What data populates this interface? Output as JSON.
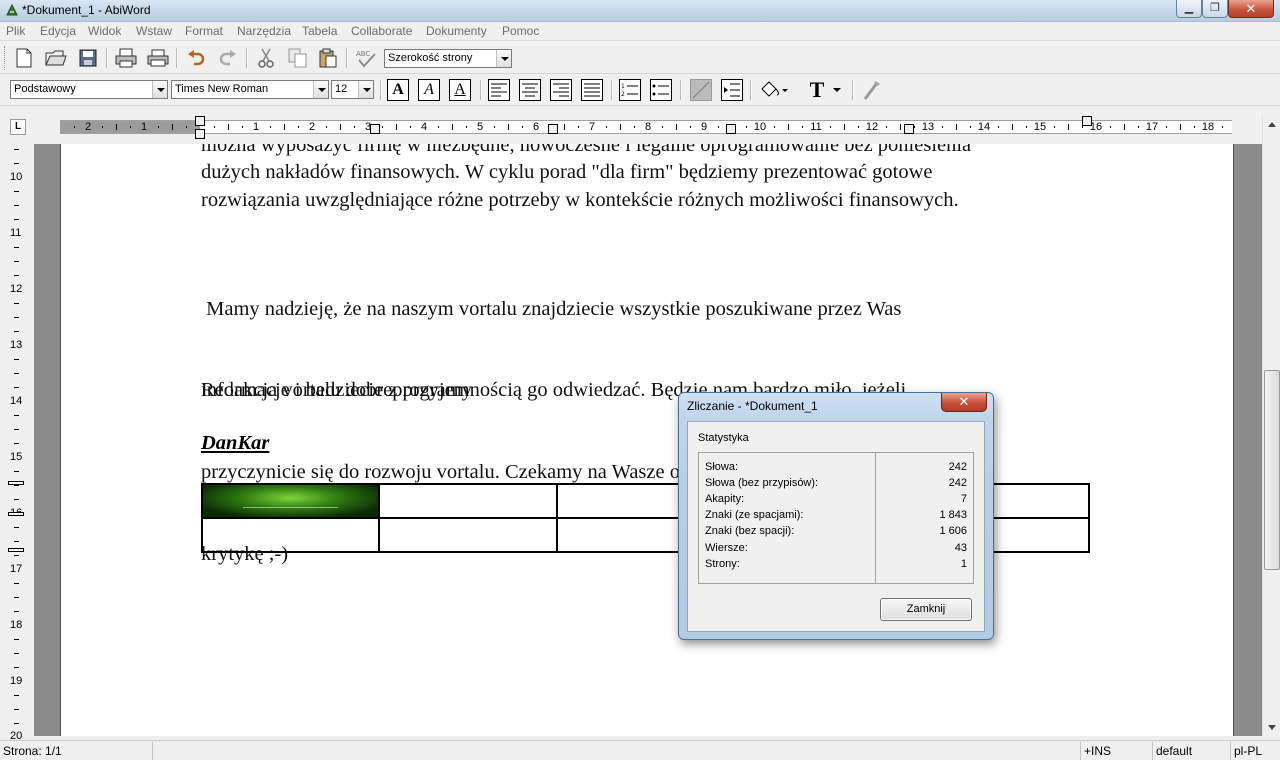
{
  "window": {
    "title": "*Dokument_1 - AbiWord",
    "min_glyph": "▁",
    "max_glyph": "❐",
    "close_glyph": "✕"
  },
  "menu": [
    "Plik",
    "Edycja",
    "Widok",
    "Wstaw",
    "Format",
    "Narzędzia",
    "Tabela",
    "Collaborate",
    "Dokumenty",
    "Pomoc"
  ],
  "toolbar": {
    "zoom": "Szerokość strony",
    "style": "Podstawowy",
    "font": "Times New Roman",
    "size": "12",
    "bold": "A",
    "italic": "A",
    "underline": "A",
    "text_color_glyph": "T"
  },
  "ruler": {
    "tab_selector": "L",
    "h_numbers_left": [
      "2",
      "1"
    ],
    "h_numbers_right": [
      "1",
      "2",
      "3",
      "4",
      "5",
      "6",
      "7",
      "8",
      "9",
      "10",
      "11",
      "12",
      "13",
      "14",
      "15",
      "16",
      "17",
      "18"
    ],
    "v_numbers": [
      "10",
      "11",
      "12",
      "13",
      "14",
      "15",
      "16",
      "17",
      "18",
      "19",
      "20"
    ]
  },
  "document": {
    "para1_lines": [
      "można wyposażyć firmę w niezbędne, nowoczesne i legalne oprogramowanie bez poniesienia",
      "dużych nakładów finansowych. W cyklu porad \"dla firm\" będziemy prezentować gotowe",
      "rozwiązania uwzględniające różne potrzeby w kontekście różnych możliwości finansowych."
    ],
    "para2_lines": [
      " Mamy nadzieję, że na naszym vortalu znajdziecie wszystkie poszukiwane przez Was",
      "informacje i bedziecie z przyjemnością go odwiedzać. Będzie nam bardzo miło, jeżeli",
      "przyczynicie się do rozwoju vortalu. Czekamy na Wasze opinie, sugestie i konstruktywną",
      "krytykę ;-)"
    ],
    "para3": "Redakcja vortalu dobreprogramy",
    "signature": "DanKar"
  },
  "dialog": {
    "title": "Zliczanie - *Dokument_1",
    "close_glyph": "✕",
    "group_label": "Statystyka",
    "stats": [
      {
        "label": "Słowa:",
        "value": "242"
      },
      {
        "label": "Słowa (bez przypisów):",
        "value": "242"
      },
      {
        "label": "Akapity:",
        "value": "7"
      },
      {
        "label": "Znaki (ze spacjami):",
        "value": "1 843"
      },
      {
        "label": "Znaki (bez spacji):",
        "value": "1 606"
      },
      {
        "label": "Wiersze:",
        "value": "43"
      },
      {
        "label": "Strony:",
        "value": "1"
      }
    ],
    "close_button": "Zamknij"
  },
  "statusbar": {
    "page": "Strona: 1/1",
    "insert_mode": "+INS",
    "style": "default",
    "language": "pl-PL"
  }
}
